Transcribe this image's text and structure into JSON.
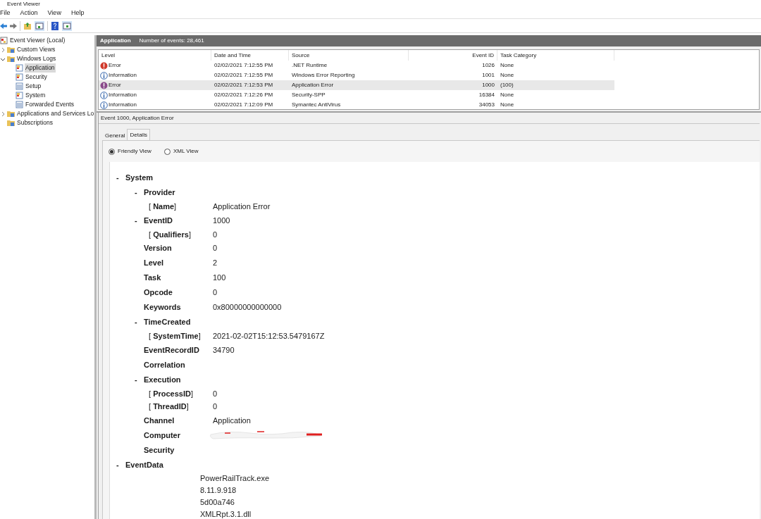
{
  "window": {
    "title": "Event Viewer"
  },
  "menu": [
    "File",
    "Action",
    "View",
    "Help"
  ],
  "tree": [
    {
      "label": "Event Viewer (Local)",
      "kind": "viewer",
      "children": [
        {
          "label": "Custom Views",
          "kind": "folder",
          "expanded": false,
          "selected": false
        },
        {
          "label": "Windows Logs",
          "kind": "folder",
          "expanded": true,
          "selected": false,
          "children": [
            {
              "label": "Application",
              "kind": "log",
              "selected": true
            },
            {
              "label": "Security",
              "kind": "log",
              "selected": false
            },
            {
              "label": "Setup",
              "kind": "plain",
              "selected": false
            },
            {
              "label": "System",
              "kind": "log",
              "selected": false
            },
            {
              "label": "Forwarded Events",
              "kind": "plain",
              "selected": false
            }
          ]
        },
        {
          "label": "Applications and Services Lo",
          "kind": "folder",
          "expanded": false,
          "selected": false
        },
        {
          "label": "Subscriptions",
          "kind": "folder",
          "selected": false
        }
      ]
    }
  ],
  "log_header": {
    "title": "Application",
    "count": "Number of events: 28,461"
  },
  "table": {
    "columns": [
      "Level",
      "Date and Time",
      "Source",
      "Event ID",
      "Task Category"
    ],
    "rows": [
      {
        "kind": "error",
        "level": "Error",
        "date": "02/02/2021 7:12:55 PM",
        "source": ".NET Runtime",
        "event_id": "1026",
        "category": "None",
        "selected": false
      },
      {
        "kind": "information",
        "level": "Information",
        "date": "02/02/2021 7:12:55 PM",
        "source": "Windows Error Reporting",
        "event_id": "1001",
        "category": "None",
        "selected": false
      },
      {
        "kind": "error",
        "level": "Error",
        "date": "02/02/2021 7:12:53 PM",
        "source": "Application Error",
        "event_id": "1000",
        "category": "(100)",
        "selected": true
      },
      {
        "kind": "information",
        "level": "Information",
        "date": "02/02/2021 7:12:26 PM",
        "source": "Security-SPP",
        "event_id": "16384",
        "category": "None",
        "selected": false
      },
      {
        "kind": "information",
        "level": "Information",
        "date": "02/02/2021 7:12:09 PM",
        "source": "Symantec AntiVirus",
        "event_id": "34053",
        "category": "None",
        "selected": false
      }
    ]
  },
  "event_title": "Event 1000, Application Error",
  "tabs": [
    {
      "label": "General",
      "selected": false
    },
    {
      "label": "Details",
      "selected": true
    }
  ],
  "views": [
    {
      "label": "Friendly View",
      "selected": true
    },
    {
      "label": "XML View",
      "selected": false
    }
  ],
  "details": [
    {
      "kind": "node",
      "toggle": "-",
      "label": "System",
      "children": [
        {
          "kind": "node",
          "toggle": "-",
          "label": "Provider",
          "children": [
            {
              "kind": "attr",
              "label": "[ **Name**]",
              "value": "Application Error"
            }
          ]
        },
        {
          "kind": "node",
          "toggle": "-",
          "label": "EventID",
          "value": "1000",
          "children": [
            {
              "kind": "attr",
              "label": "[ **Qualifiers**]",
              "value": "0"
            }
          ]
        },
        {
          "kind": "field",
          "label": "Version",
          "value": "0"
        },
        {
          "kind": "field",
          "label": "Level",
          "value": "2"
        },
        {
          "kind": "field",
          "label": "Task",
          "value": "100"
        },
        {
          "kind": "field",
          "label": "Opcode",
          "value": "0"
        },
        {
          "kind": "field",
          "label": "Keywords",
          "value": "0x80000000000000"
        },
        {
          "kind": "node",
          "toggle": "-",
          "label": "TimeCreated",
          "children": [
            {
              "kind": "attr",
              "label": "[ **SystemTime**]",
              "value": "2021-02-02T15:12:53.5479167Z"
            }
          ]
        },
        {
          "kind": "field",
          "label": "EventRecordID",
          "value": "34790"
        },
        {
          "kind": "field",
          "label": "Correlation"
        },
        {
          "kind": "node",
          "toggle": "-",
          "label": "Execution",
          "children": [
            {
              "kind": "attr",
              "label": "[ **ProcessID**]",
              "value": "0"
            },
            {
              "kind": "attr",
              "label": "[ **ThreadID**]",
              "value": "0"
            }
          ]
        },
        {
          "kind": "field",
          "label": "Channel",
          "value": "Application"
        },
        {
          "kind": "field",
          "label": "Computer",
          "redacted": true
        },
        {
          "kind": "field",
          "label": "Security"
        }
      ]
    },
    {
      "kind": "node",
      "toggle": "-",
      "label": "EventData",
      "children": [
        {
          "kind": "data",
          "value": "PowerRailTrack.exe"
        },
        {
          "kind": "data",
          "value": "8.11.9.918"
        },
        {
          "kind": "data",
          "value": "5d00a746"
        },
        {
          "kind": "data",
          "value": "XMLRpt.3.1.dll"
        }
      ]
    }
  ]
}
